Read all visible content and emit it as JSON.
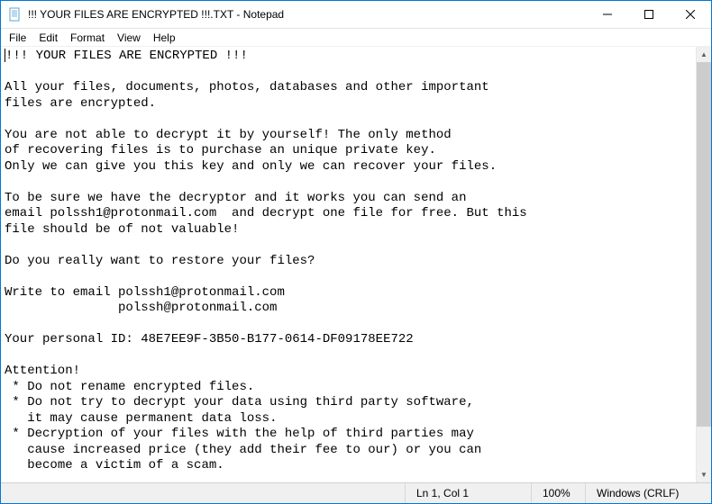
{
  "titlebar": {
    "title": "!!! YOUR FILES ARE ENCRYPTED !!!.TXT - Notepad"
  },
  "menu": {
    "file": "File",
    "edit": "Edit",
    "format": "Format",
    "view": "View",
    "help": "Help"
  },
  "content": "!!! YOUR FILES ARE ENCRYPTED !!!\n\nAll your files, documents, photos, databases and other important\nfiles are encrypted.\n\nYou are not able to decrypt it by yourself! The only method\nof recovering files is to purchase an unique private key.\nOnly we can give you this key and only we can recover your files.\n\nTo be sure we have the decryptor and it works you can send an\nemail polssh1@protonmail.com  and decrypt one file for free. But this\nfile should be of not valuable!\n\nDo you really want to restore your files?\n\nWrite to email polssh1@protonmail.com\n               polssh@protonmail.com\n\nYour personal ID: 48E7EE9F-3B50-B177-0614-DF09178EE722\n\nAttention!\n * Do not rename encrypted files.\n * Do not try to decrypt your data using third party software,\n   it may cause permanent data loss.\n * Decryption of your files with the help of third parties may\n   cause increased price (they add their fee to our) or you can\n   become a victim of a scam.",
  "statusbar": {
    "line_ending": "Windows (CRLF)",
    "position": "Ln 1, Col 1",
    "zoom": "100%"
  }
}
